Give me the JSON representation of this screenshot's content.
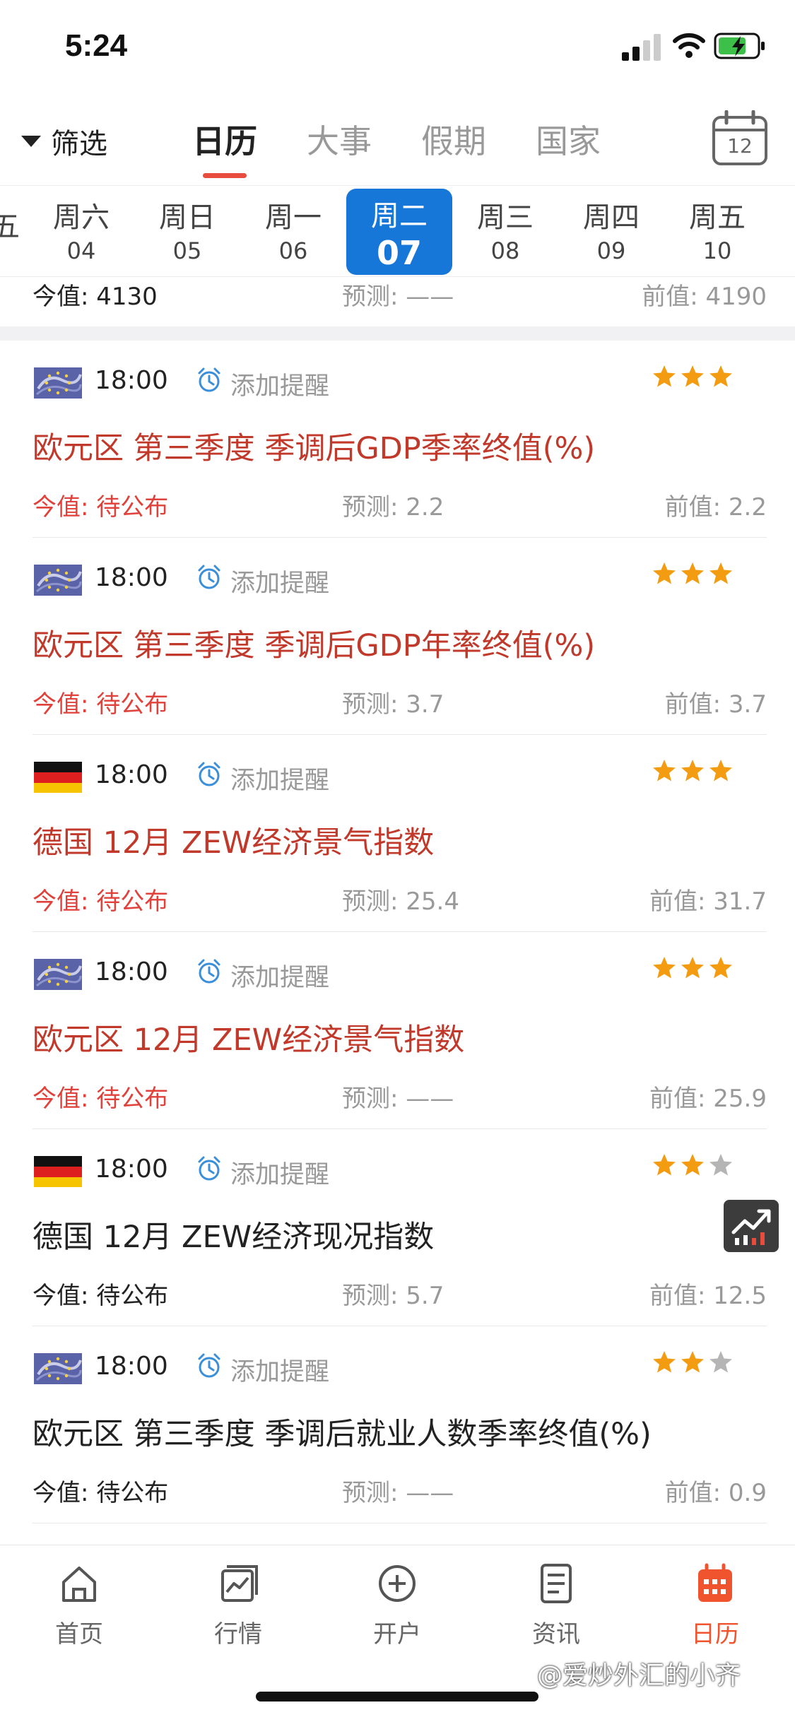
{
  "status_bar": {
    "time": "5:24"
  },
  "top_nav": {
    "filter_label": "筛选",
    "tabs": [
      {
        "label": "日历",
        "active": true
      },
      {
        "label": "大事",
        "active": false
      },
      {
        "label": "假期",
        "active": false
      },
      {
        "label": "国家",
        "active": false
      }
    ],
    "calendar_day": "12"
  },
  "week": {
    "partial_left": "五",
    "days": [
      {
        "weekday": "周六",
        "date": "04",
        "selected": false
      },
      {
        "weekday": "周日",
        "date": "05",
        "selected": false
      },
      {
        "weekday": "周一",
        "date": "06",
        "selected": false
      },
      {
        "weekday": "周二",
        "date": "07",
        "selected": true
      },
      {
        "weekday": "周三",
        "date": "08",
        "selected": false
      },
      {
        "weekday": "周四",
        "date": "09",
        "selected": false
      },
      {
        "weekday": "周五",
        "date": "10",
        "selected": false
      }
    ]
  },
  "previous_row": {
    "actual": "今值: 4130",
    "forecast": "预测: ——",
    "previous": "前值: 4190"
  },
  "events": [
    {
      "flag": "eu-flag",
      "time": "18:00",
      "remind": "添加提醒",
      "stars": 3,
      "important": true,
      "title": "欧元区 第三季度 季调后GDP季率终值(%)",
      "actual": "今值: 待公布",
      "forecast": "预测: 2.2",
      "previous": "前值: 2.2"
    },
    {
      "flag": "eu-flag",
      "time": "18:00",
      "remind": "添加提醒",
      "stars": 3,
      "important": true,
      "title": "欧元区 第三季度 季调后GDP年率终值(%)",
      "actual": "今值: 待公布",
      "forecast": "预测: 3.7",
      "previous": "前值: 3.7"
    },
    {
      "flag": "germany-flag",
      "time": "18:00",
      "remind": "添加提醒",
      "stars": 3,
      "important": true,
      "title": "德国 12月 ZEW经济景气指数",
      "actual": "今值: 待公布",
      "forecast": "预测: 25.4",
      "previous": "前值: 31.7"
    },
    {
      "flag": "eu-flag",
      "time": "18:00",
      "remind": "添加提醒",
      "stars": 3,
      "important": true,
      "title": "欧元区 12月 ZEW经济景气指数",
      "actual": "今值: 待公布",
      "forecast": "预测: ——",
      "previous": "前值: 25.9"
    },
    {
      "flag": "germany-flag",
      "time": "18:00",
      "remind": "添加提醒",
      "stars": 2,
      "important": false,
      "title": "德国 12月 ZEW经济现况指数",
      "actual": "今值: 待公布",
      "forecast": "预测: 5.7",
      "previous": "前值: 12.5"
    },
    {
      "flag": "eu-flag",
      "time": "18:00",
      "remind": "添加提醒",
      "stars": 2,
      "important": false,
      "title": "欧元区 第三季度 季调后就业人数季率终值(%)",
      "actual": "今值: 待公布",
      "forecast": "预测: ——",
      "previous": "前值: 0.9"
    }
  ],
  "bottom_tabs": [
    {
      "label": "首页",
      "icon": "home-icon",
      "active": false
    },
    {
      "label": "行情",
      "icon": "market-chart-icon",
      "active": false
    },
    {
      "label": "开户",
      "icon": "plus-circle-icon",
      "active": false
    },
    {
      "label": "资讯",
      "icon": "news-document-icon",
      "active": false
    },
    {
      "label": "日历",
      "icon": "calendar-icon",
      "active": true
    }
  ],
  "watermark": "@爱炒外汇的小齐",
  "colors": {
    "accent_blue": "#1677d9",
    "important_red": "#c0392b",
    "star_orange": "#f39c12",
    "tab_active": "#f0542e"
  }
}
